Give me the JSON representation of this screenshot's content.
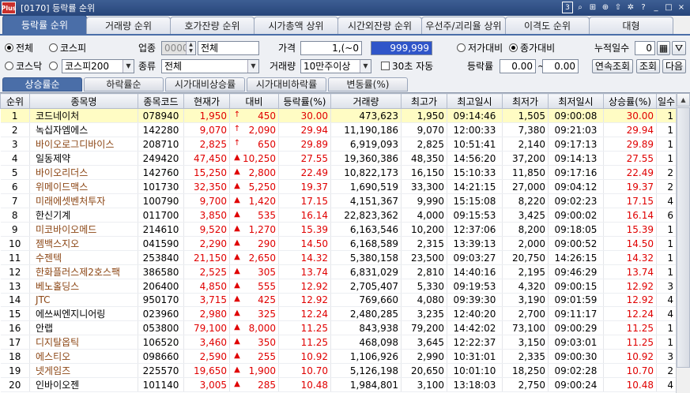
{
  "window": {
    "title": "[0170] 등락률 순위",
    "logo": "Plus",
    "tools": [
      "3",
      "search-icon",
      "grid-icon",
      "zoom-in-icon",
      "up-icon",
      "pin-icon",
      "?",
      "_",
      "□",
      "×"
    ]
  },
  "main_tabs": [
    "등락률 순위",
    "거래량 순위",
    "호가잔량 순위",
    "시가총액 상위",
    "시간외잔량 순위",
    "우선주/괴리율 상위",
    "이격도 순위",
    "대형"
  ],
  "filters": {
    "market_all": "전체",
    "market_kospi": "코스피",
    "market_kosdaq": "코스닥",
    "index_select": "코스피200",
    "sector_label": "업종",
    "sector_code": "0000",
    "sector_name": "전체",
    "type_label": "종류",
    "type_value": "전체",
    "price_label": "가격",
    "price_from": "1,(~0",
    "price_to": "999,999",
    "volume_label": "거래량",
    "volume_value": "10만주이상",
    "auto_label": "30초 자동",
    "vs_low": "저가대비",
    "vs_close": "종가대비",
    "rate_label": "등락률",
    "rate_from": "0.00",
    "rate_sep": "~",
    "rate_to": "0.00",
    "days_label": "누적일수",
    "days_value": "0",
    "btn_continuous": "연속조회",
    "btn_query": "조회",
    "btn_next": "다음"
  },
  "sub_tabs": [
    "상승률순",
    "하락률순",
    "시가대비상승률",
    "시가대비하락률",
    "변동률(%)"
  ],
  "columns": [
    "순위",
    "종목명",
    "종목코드",
    "현재가",
    "대비",
    "등락률(%)",
    "거래량",
    "최고가",
    "최고일시",
    "최저가",
    "최저일시",
    "상승률(%)",
    "일수"
  ],
  "rows": [
    {
      "rank": "1",
      "name": "코드네이처",
      "code": "078940",
      "price": "1,950",
      "sign": "↑",
      "diff": "450",
      "rate": "30.00",
      "volume": "473,623",
      "high": "1,950",
      "high_time": "09:14:46",
      "low": "1,505",
      "low_time": "09:00:08",
      "rise": "30.00",
      "days": "1"
    },
    {
      "rank": "2",
      "name": "녹십자엠에스",
      "code": "142280",
      "price": "9,070",
      "sign": "↑",
      "diff": "2,090",
      "rate": "29.94",
      "volume": "11,190,186",
      "high": "9,070",
      "high_time": "12:00:33",
      "low": "7,380",
      "low_time": "09:21:03",
      "rise": "29.94",
      "days": "1"
    },
    {
      "rank": "3",
      "name": "바이오로그디바이스",
      "code": "208710",
      "price": "2,825",
      "sign": "↑",
      "diff": "650",
      "rate": "29.89",
      "volume": "6,919,093",
      "high": "2,825",
      "high_time": "10:51:41",
      "low": "2,140",
      "low_time": "09:17:13",
      "rise": "29.89",
      "days": "1"
    },
    {
      "rank": "4",
      "name": "일동제약",
      "code": "249420",
      "price": "47,450",
      "sign": "▲",
      "diff": "10,250",
      "rate": "27.55",
      "volume": "19,360,386",
      "high": "48,350",
      "high_time": "14:56:20",
      "low": "37,200",
      "low_time": "09:14:13",
      "rise": "27.55",
      "days": "1"
    },
    {
      "rank": "5",
      "name": "바이오리더스",
      "code": "142760",
      "price": "15,250",
      "sign": "▲",
      "diff": "2,800",
      "rate": "22.49",
      "volume": "10,822,173",
      "high": "16,150",
      "high_time": "15:10:33",
      "low": "11,850",
      "low_time": "09:17:16",
      "rise": "22.49",
      "days": "2"
    },
    {
      "rank": "6",
      "name": "위메이드맥스",
      "code": "101730",
      "price": "32,350",
      "sign": "▲",
      "diff": "5,250",
      "rate": "19.37",
      "volume": "1,690,519",
      "high": "33,300",
      "high_time": "14:21:15",
      "low": "27,000",
      "low_time": "09:04:12",
      "rise": "19.37",
      "days": "2"
    },
    {
      "rank": "7",
      "name": "미래에셋벤처투자",
      "code": "100790",
      "price": "9,700",
      "sign": "▲",
      "diff": "1,420",
      "rate": "17.15",
      "volume": "4,151,367",
      "high": "9,990",
      "high_time": "15:15:08",
      "low": "8,220",
      "low_time": "09:02:23",
      "rise": "17.15",
      "days": "4"
    },
    {
      "rank": "8",
      "name": "한신기계",
      "code": "011700",
      "price": "3,850",
      "sign": "▲",
      "diff": "535",
      "rate": "16.14",
      "volume": "22,823,362",
      "high": "4,000",
      "high_time": "09:15:53",
      "low": "3,425",
      "low_time": "09:00:02",
      "rise": "16.14",
      "days": "6"
    },
    {
      "rank": "9",
      "name": "미코바이오메드",
      "code": "214610",
      "price": "9,520",
      "sign": "▲",
      "diff": "1,270",
      "rate": "15.39",
      "volume": "6,163,546",
      "high": "10,200",
      "high_time": "12:37:06",
      "low": "8,200",
      "low_time": "09:18:05",
      "rise": "15.39",
      "days": "1"
    },
    {
      "rank": "10",
      "name": "젬백스지오",
      "code": "041590",
      "price": "2,290",
      "sign": "▲",
      "diff": "290",
      "rate": "14.50",
      "volume": "6,168,589",
      "high": "2,315",
      "high_time": "13:39:13",
      "low": "2,000",
      "low_time": "09:00:52",
      "rise": "14.50",
      "days": "1"
    },
    {
      "rank": "11",
      "name": "수젠텍",
      "code": "253840",
      "price": "21,150",
      "sign": "▲",
      "diff": "2,650",
      "rate": "14.32",
      "volume": "5,380,158",
      "high": "23,500",
      "high_time": "09:03:27",
      "low": "20,750",
      "low_time": "14:26:15",
      "rise": "14.32",
      "days": "1"
    },
    {
      "rank": "12",
      "name": "한화플러스제2호스팩",
      "code": "386580",
      "price": "2,525",
      "sign": "▲",
      "diff": "305",
      "rate": "13.74",
      "volume": "6,831,029",
      "high": "2,810",
      "high_time": "14:40:16",
      "low": "2,195",
      "low_time": "09:46:29",
      "rise": "13.74",
      "days": "1"
    },
    {
      "rank": "13",
      "name": "베노홀딩스",
      "code": "206400",
      "price": "4,850",
      "sign": "▲",
      "diff": "555",
      "rate": "12.92",
      "volume": "2,705,407",
      "high": "5,330",
      "high_time": "09:19:53",
      "low": "4,320",
      "low_time": "09:00:15",
      "rise": "12.92",
      "days": "3"
    },
    {
      "rank": "14",
      "name": "JTC",
      "code": "950170",
      "price": "3,715",
      "sign": "▲",
      "diff": "425",
      "rate": "12.92",
      "volume": "769,660",
      "high": "4,080",
      "high_time": "09:39:30",
      "low": "3,190",
      "low_time": "09:01:59",
      "rise": "12.92",
      "days": "4"
    },
    {
      "rank": "15",
      "name": "에쓰씨엔지니어링",
      "code": "023960",
      "price": "2,980",
      "sign": "▲",
      "diff": "325",
      "rate": "12.24",
      "volume": "2,480,285",
      "high": "3,235",
      "high_time": "12:40:20",
      "low": "2,700",
      "low_time": "09:11:17",
      "rise": "12.24",
      "days": "4"
    },
    {
      "rank": "16",
      "name": "안랩",
      "code": "053800",
      "price": "79,100",
      "sign": "▲",
      "diff": "8,000",
      "rate": "11.25",
      "volume": "843,938",
      "high": "79,200",
      "high_time": "14:42:02",
      "low": "73,100",
      "low_time": "09:00:29",
      "rise": "11.25",
      "days": "1"
    },
    {
      "rank": "17",
      "name": "디지탈옵틱",
      "code": "106520",
      "price": "3,460",
      "sign": "▲",
      "diff": "350",
      "rate": "11.25",
      "volume": "468,098",
      "high": "3,645",
      "high_time": "12:22:37",
      "low": "3,150",
      "low_time": "09:03:01",
      "rise": "11.25",
      "days": "1"
    },
    {
      "rank": "18",
      "name": "에스티오",
      "code": "098660",
      "price": "2,590",
      "sign": "▲",
      "diff": "255",
      "rate": "10.92",
      "volume": "1,106,926",
      "high": "2,990",
      "high_time": "10:31:01",
      "low": "2,335",
      "low_time": "09:00:30",
      "rise": "10.92",
      "days": "3"
    },
    {
      "rank": "19",
      "name": "넷게임즈",
      "code": "225570",
      "price": "19,650",
      "sign": "▲",
      "diff": "1,900",
      "rate": "10.70",
      "volume": "5,126,198",
      "high": "20,650",
      "high_time": "10:01:10",
      "low": "18,250",
      "low_time": "09:02:28",
      "rise": "10.70",
      "days": "2"
    },
    {
      "rank": "20",
      "name": "인바이오젠",
      "code": "101140",
      "price": "3,005",
      "sign": "▲",
      "diff": "285",
      "rate": "10.48",
      "volume": "1,984,801",
      "high": "3,100",
      "high_time": "13:18:03",
      "low": "2,750",
      "low_time": "09:00:24",
      "rise": "10.48",
      "days": "4"
    }
  ],
  "colors": {
    "up": "#e00000",
    "accent": "#4a6ea8",
    "selected_row": "#fffcc4",
    "name_special": "#8b4513"
  }
}
